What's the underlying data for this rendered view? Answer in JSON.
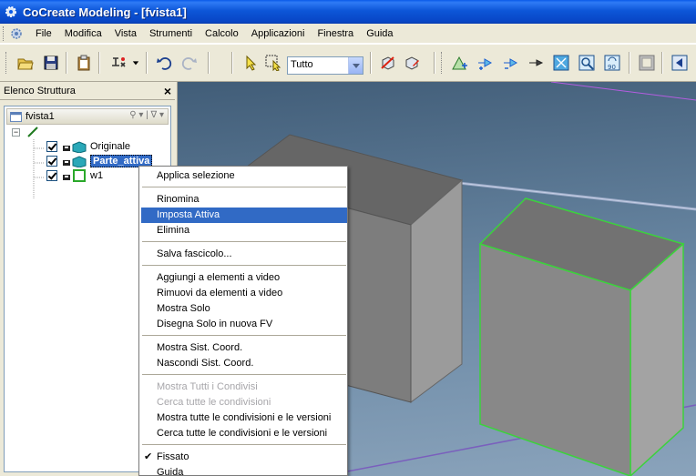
{
  "window": {
    "title": "CoCreate Modeling - [fvista1]"
  },
  "menu": {
    "items": [
      {
        "label": "File"
      },
      {
        "label": "Modifica"
      },
      {
        "label": "Vista"
      },
      {
        "label": "Strumenti"
      },
      {
        "label": "Calcolo"
      },
      {
        "label": "Applicazioni"
      },
      {
        "label": "Finestra"
      },
      {
        "label": "Guida"
      }
    ]
  },
  "toolbar": {
    "filter_value": "Tutto",
    "icons": [
      "open-folder-icon",
      "save-icon",
      "clipboard-icon",
      "structure-tool-icon",
      "undo-icon",
      "redo-icon",
      "select-arrow-icon",
      "select-box-icon",
      "cut-part-icon",
      "edit-part-icon",
      "view-tree-icon",
      "zoom-in-icon",
      "zoom-out-icon",
      "fit-icon",
      "zoom-window-icon",
      "rotate-90-icon",
      "frame-icon",
      "previous-icon"
    ]
  },
  "panel": {
    "title": "Elenco Struttura",
    "root": "fvista1",
    "items": [
      {
        "label": "Originale",
        "checked": true
      },
      {
        "label": "Parte_attiva",
        "checked": true,
        "selected": true
      },
      {
        "label": "w1",
        "checked": true
      }
    ]
  },
  "context_menu": {
    "items": [
      {
        "label": "Applica selezione"
      },
      {
        "label": "Rinomina"
      },
      {
        "label": "Imposta Attiva",
        "highlighted": true
      },
      {
        "label": "Elimina"
      },
      {
        "label": "Salva fascicolo..."
      },
      {
        "label": "Aggiungi a elementi a video"
      },
      {
        "label": "Rimuovi da elementi a video"
      },
      {
        "label": "Mostra Solo"
      },
      {
        "label": "Disegna Solo in nuova FV"
      },
      {
        "label": "Mostra Sist. Coord."
      },
      {
        "label": "Nascondi Sist. Coord."
      },
      {
        "label": "Mostra Tutti i Condivisi",
        "disabled": true
      },
      {
        "label": "Cerca tutte le condivisioni",
        "disabled": true
      },
      {
        "label": "Mostra tutte le condivisioni e le versioni"
      },
      {
        "label": "Cerca tutte le condivisioni e le versioni"
      },
      {
        "label": "Fissato",
        "checked": true
      },
      {
        "label": "Guida"
      }
    ]
  },
  "colors": {
    "titlebar": "#0a5ae8",
    "highlight": "#316ac5",
    "active_edge": "#3cd23c",
    "part_face": "#808080"
  }
}
